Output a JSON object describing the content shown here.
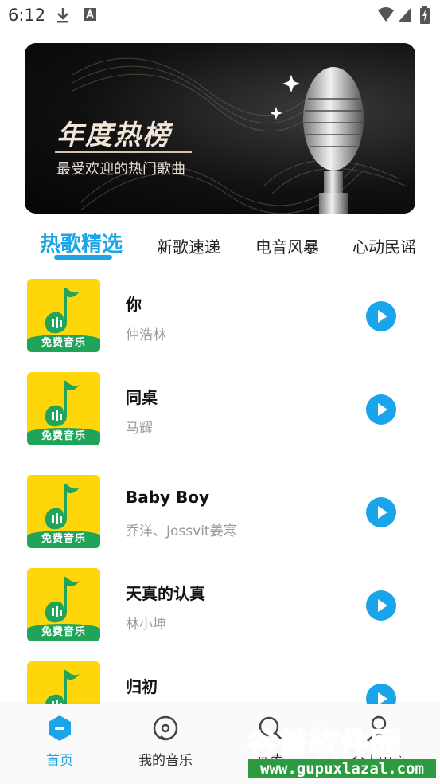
{
  "status_bar": {
    "time": "6:12"
  },
  "banner": {
    "title": "年度热榜",
    "subtitle": "最受欢迎的热门歌曲"
  },
  "tabs": [
    {
      "label": "热歌精选",
      "active": true
    },
    {
      "label": "新歌速递",
      "active": false
    },
    {
      "label": "电音风暴",
      "active": false
    },
    {
      "label": "心动民谣",
      "active": false
    }
  ],
  "cover_label": "免费音乐",
  "songs": [
    {
      "title": "你",
      "artist": "仲浩林"
    },
    {
      "title": "同桌",
      "artist": "马耀"
    },
    {
      "title": "Baby Boy",
      "artist": "乔洋、Jossvit姜寒"
    },
    {
      "title": "天真的认真",
      "artist": "林小坤"
    },
    {
      "title": "归初",
      "artist": ""
    }
  ],
  "bottom_nav": [
    {
      "label": "首页",
      "icon": "home-icon",
      "active": true
    },
    {
      "label": "我的音乐",
      "icon": "music-disc-icon",
      "active": false
    },
    {
      "label": "搜索",
      "icon": "search-icon",
      "active": false
    },
    {
      "label": "个人中心",
      "icon": "profile-icon",
      "active": false
    }
  ],
  "watermark": {
    "title": "谷普软件园",
    "url": "www.gupuxlazal.com"
  },
  "colors": {
    "accent": "#1aa5ea",
    "cover_yellow": "#ffd60a",
    "cover_green": "#1fa45a"
  }
}
